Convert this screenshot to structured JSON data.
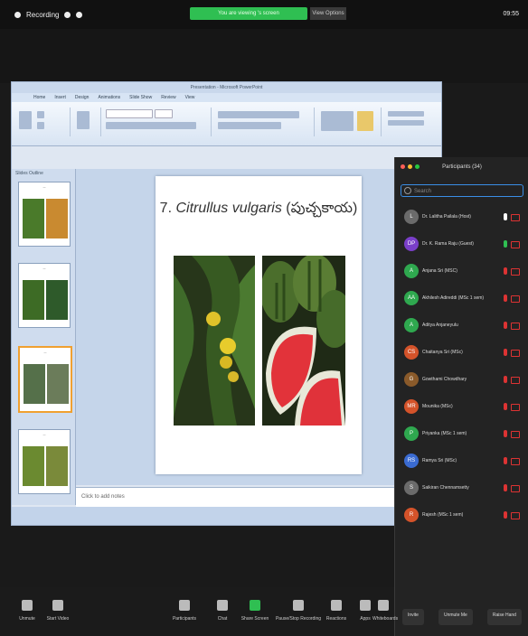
{
  "topbar": {
    "left": "Recording",
    "banner": "You are viewing 's screen",
    "view_options": "View Options",
    "right": "09:55"
  },
  "ppt": {
    "title": "Presentation - Microsoft PowerPoint",
    "tabs": [
      "Home",
      "Insert",
      "Design",
      "Animations",
      "Slide Show",
      "Review",
      "View"
    ],
    "panel_tabs": "Slides  Outline",
    "notes_placeholder": "Click to add notes",
    "slide_title_prefix": "7. ",
    "slide_title_italic": "Citrullus vulgaris",
    "slide_title_suffix": " (పుచ్చకాయ)"
  },
  "participants": {
    "header": "Participants (34)",
    "search_placeholder": "Search",
    "list": [
      {
        "name": "Dr. Lalitha Pailala (Host)",
        "initials": "L",
        "color": "#6b6b6b",
        "mic": "#ffffff"
      },
      {
        "name": "Dr. K. Rama Raju (Guest)",
        "initials": "DP",
        "color": "#7a3fc9",
        "mic": "#2fbf52"
      },
      {
        "name": "Anjana Sri (MSC)",
        "initials": "A",
        "color": "#2fa84f",
        "mic": "#d33"
      },
      {
        "name": "Akhilesh Adireddi (MSc 1 sem)",
        "initials": "AA",
        "color": "#2fa84f",
        "mic": "#d33"
      },
      {
        "name": "Aditya Anjaneyulu",
        "initials": "A",
        "color": "#2fa84f",
        "mic": "#d33"
      },
      {
        "name": "Chaitanya Sri (MSc)",
        "initials": "CS",
        "color": "#d4532a",
        "mic": "#d33"
      },
      {
        "name": "Gowthami Chowdhary",
        "initials": "G",
        "color": "#8a5a2a",
        "mic": "#d33"
      },
      {
        "name": "Mounika (MSc)",
        "initials": "MR",
        "color": "#d4532a",
        "mic": "#d33"
      },
      {
        "name": "Priyanka (MSc 1 sem)",
        "initials": "P",
        "color": "#2fa84f",
        "mic": "#d33"
      },
      {
        "name": "Ramya Sri (MSc)",
        "initials": "RS",
        "color": "#3a6bd1",
        "mic": "#d33"
      },
      {
        "name": "Saikiran Chennamsetty",
        "initials": "S",
        "color": "#6b6b6b",
        "mic": "#d33"
      },
      {
        "name": "Rajesh (MSc 1 sem)",
        "initials": "R",
        "color": "#d4532a",
        "mic": "#d33"
      }
    ],
    "buttons": [
      "Invite",
      "Unmute Me",
      "Raise Hand"
    ]
  },
  "toolbar": {
    "items": [
      "Unmute",
      "Start Video",
      "Participants",
      "Chat",
      "Share Screen",
      "Pause/Stop Recording",
      "Reactions",
      "Apps",
      "Whiteboards"
    ]
  }
}
